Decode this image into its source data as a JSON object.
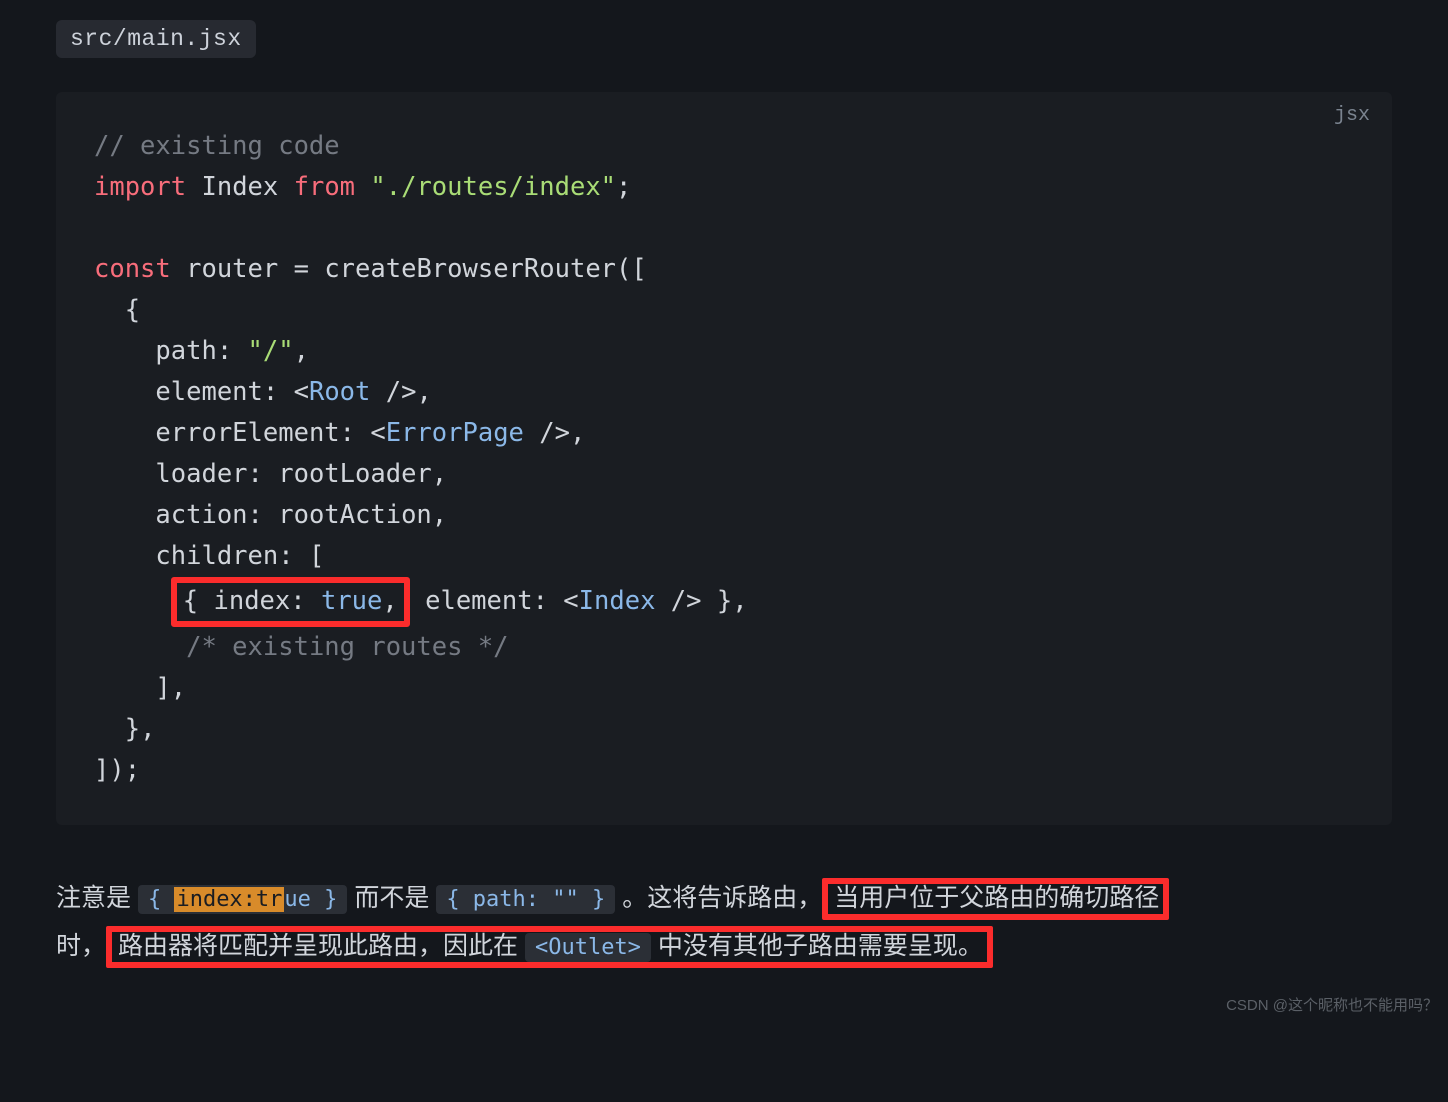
{
  "filename": "src/main.jsx",
  "lang_tag": "jsx",
  "code": {
    "l1_comment": "// existing code",
    "import_kw": "import",
    "import_name": "Index",
    "from_kw": "from",
    "import_path": "\"./routes/index\"",
    "const_kw": "const",
    "router_var": "router",
    "eq": "=",
    "create_fn": "createBrowserRouter",
    "path_key": "path:",
    "path_val": "\"/\"",
    "element_key": "element:",
    "root_comp": "Root",
    "error_key": "errorElement:",
    "error_comp": "ErrorPage",
    "loader_key": "loader:",
    "loader_val": "rootLoader",
    "action_key": "action:",
    "action_val": "rootAction",
    "children_key": "children:",
    "index_key": "index:",
    "true_val": "true",
    "element_key2": "element:",
    "index_comp": "Index",
    "routes_comment": "/* existing routes */"
  },
  "prose": {
    "p1": "注意是 ",
    "code1_a": "{ ",
    "code1_hl": "index:tr",
    "code1_b": "ue }",
    "p2": " 而不是 ",
    "code2": "{ path: \"\" }",
    "p3": " 。这将告诉路由，",
    "red1": "当用户位于父路由的确切路径",
    "p4": "时，",
    "red2": "路由器将匹配并呈现此路由，因此在 ",
    "outlet": "<Outlet>",
    "red3": " 中没有其他子路由需要呈现。"
  },
  "watermark": "CSDN @这个昵称也不能用吗？"
}
